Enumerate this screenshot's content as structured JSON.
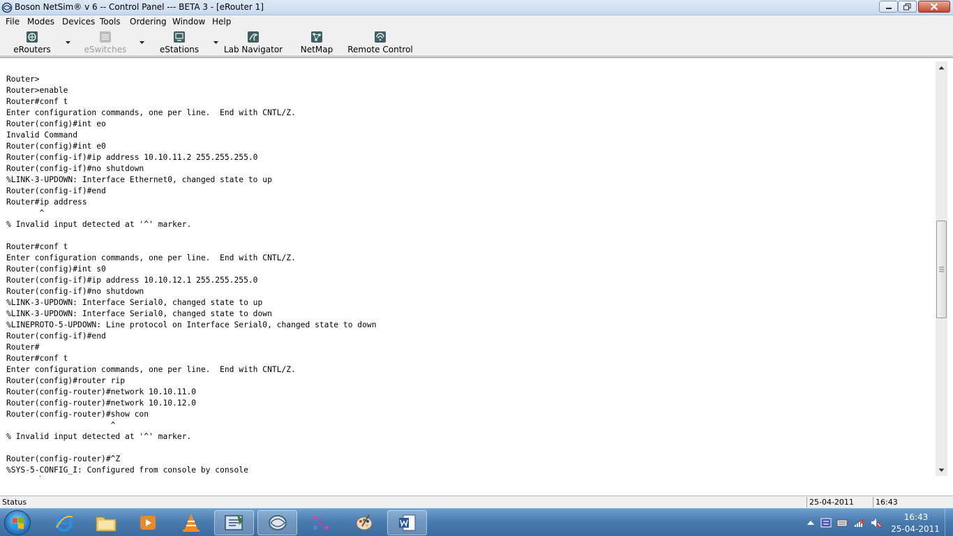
{
  "window": {
    "title": "Boson NetSim®  v 6 -- Control Panel --- BETA 3 - [eRouter 1]"
  },
  "menu": {
    "items": [
      "File",
      "Modes",
      "Devices",
      "Tools",
      "Ordering",
      "Window",
      "Help"
    ]
  },
  "toolbar": {
    "erouters": "eRouters",
    "eswitches": "eSwitches",
    "estations": "eStations",
    "lab_navigator": "Lab Navigator",
    "netmap": "NetMap",
    "remote_control": "Remote Control"
  },
  "terminal": {
    "lines": [
      "Router>",
      "Router>enable",
      "Router#conf t",
      "Enter configuration commands, one per line.  End with CNTL/Z.",
      "Router(config)#int eo",
      "Invalid Command",
      "Router(config)#int e0",
      "Router(config-if)#ip address 10.10.11.2 255.255.255.0",
      "Router(config-if)#no shutdown",
      "%LINK-3-UPDOWN: Interface Ethernet0, changed state to up",
      "Router(config-if)#end",
      "Router#ip address",
      "       ^",
      "% Invalid input detected at '^' marker.",
      "",
      "Router#conf t",
      "Enter configuration commands, one per line.  End with CNTL/Z.",
      "Router(config)#int s0",
      "Router(config-if)#ip address 10.10.12.1 255.255.255.0",
      "Router(config-if)#no shutdown",
      "%LINK-3-UPDOWN: Interface Serial0, changed state to up",
      "%LINK-3-UPDOWN: Interface Serial0, changed state to down",
      "%LINEPROTO-5-UPDOWN: Line protocol on Interface Serial0, changed state to down",
      "Router(config-if)#end",
      "Router#",
      "Router#conf t",
      "Enter configuration commands, one per line.  End with CNTL/Z.",
      "Router(config)#router rip",
      "Router(config-router)#network 10.10.11.0",
      "Router(config-router)#network 10.10.12.0",
      "Router(config-router)#show con",
      "                      ^",
      "% Invalid input detected at '^' marker.",
      "",
      "Router(config-router)#^Z",
      "%SYS-5-CONFIG_I: Configured from console by console"
    ],
    "prompt": "Router#"
  },
  "status": {
    "label": "Status",
    "date": "25-04-2011",
    "time": "16:43"
  },
  "taskbar": {
    "clock_time": "16:43",
    "clock_date": "25-04-2011"
  }
}
